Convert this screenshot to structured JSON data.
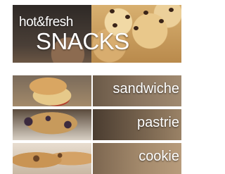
{
  "hero": {
    "tagline": "hot&fresh",
    "title": "SNACKS"
  },
  "categories": [
    {
      "label": "sandwiche",
      "image": "sandwich-photo"
    },
    {
      "label": "pastrie",
      "image": "muffin-pastry-photo"
    },
    {
      "label": "cookie",
      "image": "cookies-photo"
    }
  ]
}
